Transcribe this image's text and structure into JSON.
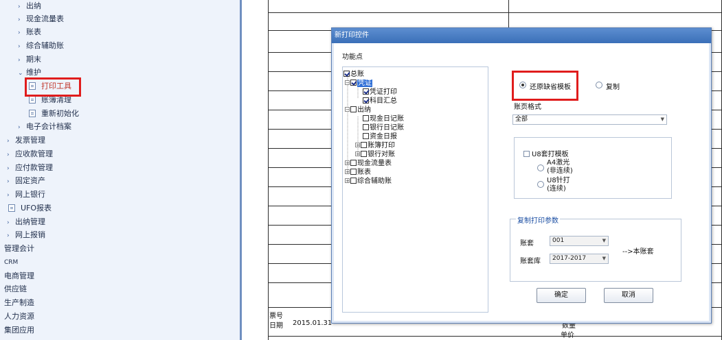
{
  "sidebar": {
    "items": [
      {
        "label": "出纳"
      },
      {
        "label": "现金流量表"
      },
      {
        "label": "账表"
      },
      {
        "label": "综合辅助账"
      },
      {
        "label": "期末"
      },
      {
        "label": "维护"
      },
      {
        "label": "打印工具"
      },
      {
        "label": "账簿清理"
      },
      {
        "label": "重新初始化"
      },
      {
        "label": "电子会计档案"
      },
      {
        "label": "发票管理"
      },
      {
        "label": "应收款管理"
      },
      {
        "label": "应付款管理"
      },
      {
        "label": "固定资产"
      },
      {
        "label": "网上银行"
      },
      {
        "label": "UFO报表"
      },
      {
        "label": "出纳管理"
      },
      {
        "label": "网上报销"
      },
      {
        "label": "管理会计"
      },
      {
        "label": "CRM"
      },
      {
        "label": "电商管理"
      },
      {
        "label": "供应链"
      },
      {
        "label": "生产制造"
      },
      {
        "label": "人力资源"
      },
      {
        "label": "集团应用"
      }
    ]
  },
  "form": {
    "ticket_label": "票号",
    "date_label": "日期",
    "date_value": "2015.01.31",
    "qty_label": "数量",
    "price_label": "单价"
  },
  "dialog": {
    "title": "新打印控件",
    "func_label": "功能点",
    "tree": [
      {
        "label": "总账"
      },
      {
        "label": "凭证"
      },
      {
        "label": "凭证打印"
      },
      {
        "label": "科目汇总"
      },
      {
        "label": "出纳"
      },
      {
        "label": "现金日记账"
      },
      {
        "label": "银行日记账"
      },
      {
        "label": "资金日报"
      },
      {
        "label": "账簿打印"
      },
      {
        "label": "银行对账"
      },
      {
        "label": "现金流量表"
      },
      {
        "label": "账表"
      },
      {
        "label": "综合辅助账"
      }
    ],
    "radio_restore": "还原缺省模板",
    "radio_copy": "复制",
    "page_format_label": "账页格式",
    "page_format_value": "全部",
    "u8_template_label": "U8套打模板",
    "a4_laser_line1": "A4激光",
    "a4_laser_line2": "(非连续)",
    "u8_needle_line1": "U8针打",
    "u8_needle_line2": "(连续)",
    "copy_params_title": "复制打印参数",
    "account_set_label": "账套",
    "account_set_value": "001",
    "account_db_label": "账套库",
    "account_db_value": "2017-2017",
    "to_this_account": "-->本账套",
    "ok_button": "确定",
    "cancel_button": "取消"
  }
}
